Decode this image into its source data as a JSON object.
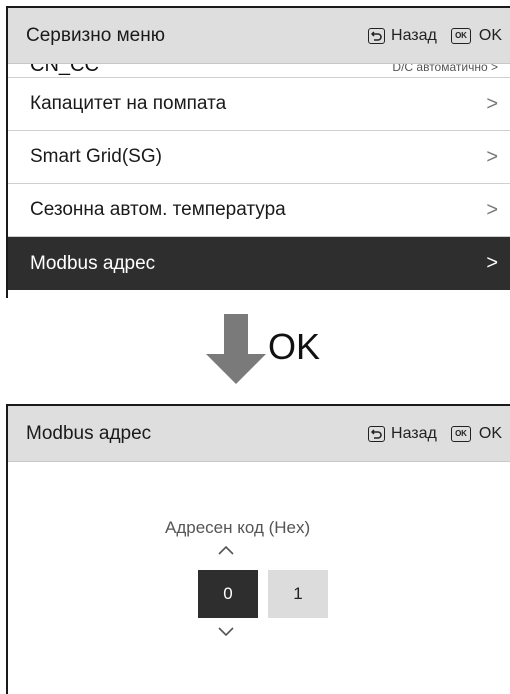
{
  "screen1": {
    "header": {
      "title": "Сервизно меню",
      "back_label": "Назад",
      "ok_icon": "OK",
      "ok_label": "OK"
    },
    "cut_item": {
      "label": "CN_CC",
      "value": "D/C автоматично",
      "chevron": ">"
    },
    "items": [
      {
        "label": "Капацитет на помпата",
        "chevron": ">"
      },
      {
        "label": "Smart Grid(SG)",
        "chevron": ">"
      },
      {
        "label": "Сезонна автом. температура",
        "chevron": ">"
      },
      {
        "label": "Modbus адрес",
        "chevron": ">",
        "selected": true
      }
    ]
  },
  "transition": {
    "label": "OK"
  },
  "screen2": {
    "header": {
      "title": "Modbus адрес",
      "back_label": "Назад",
      "ok_icon": "OK",
      "ok_label": "OK"
    },
    "code_label": "Адресен код (Hex)",
    "digits": [
      "0",
      "1"
    ],
    "up_icon": "chevron-up-icon",
    "down_icon": "chevron-down-icon"
  },
  "colors": {
    "header_bg": "#dedede",
    "selected_bg": "#2e2e2e",
    "arrow": "#7a7a7a",
    "digit_inactive": "#dcdcdc"
  }
}
